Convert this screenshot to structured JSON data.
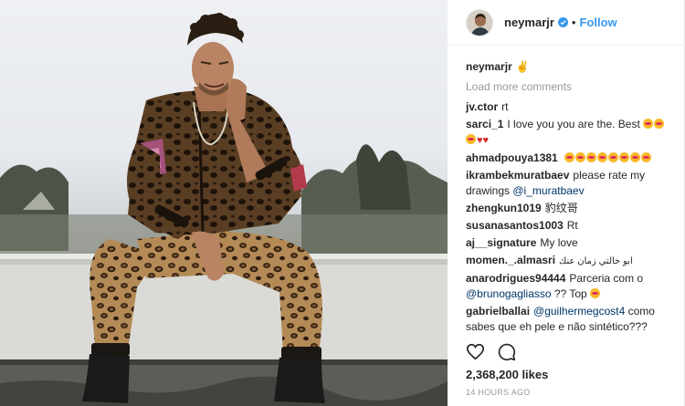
{
  "post": {
    "username": "neymarjr",
    "follow_label": "Follow",
    "separator": "•",
    "caption_emoji": "✌️",
    "load_more": "Load more comments",
    "likes": "2,368,200 likes",
    "timestamp": "14 HOURS AGO"
  },
  "comments": [
    {
      "user": "jv.ctor",
      "text": "rt"
    },
    {
      "user": "sarci_1",
      "text": "I love you you are the. Best"
    },
    {
      "user": "ahmadpouya1381",
      "text": ""
    },
    {
      "user": "ikrambekmuratbaev",
      "text": "please rate my drawings",
      "mention": "@i_muratbaev"
    },
    {
      "user": "zhengkun1019",
      "text": "豹纹哥"
    },
    {
      "user": "susanasantos1003",
      "text": "Rt"
    },
    {
      "user": "aj__signature",
      "text": "My love"
    },
    {
      "user": "momen._.almasri",
      "text": "ابو خالتي زمان عنك"
    },
    {
      "user": "anarodrigues94444",
      "text": "Parceria com o",
      "mention": "@brunogagliasso",
      "text2": "?? Top"
    },
    {
      "user": "gabrielballai",
      "mention": "@guilhermegcost4",
      "text": "como sabes que eh pele e não sintético???"
    }
  ],
  "icons": {
    "verified": "verified-badge-icon",
    "heart": "heart-icon",
    "comment": "comment-icon"
  },
  "colors": {
    "accent": "#3897f0",
    "mention": "#003569",
    "muted": "#999999"
  }
}
